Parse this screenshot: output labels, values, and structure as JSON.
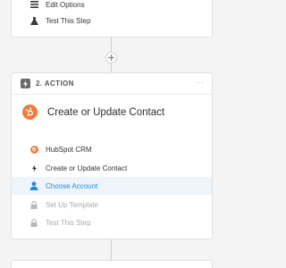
{
  "top_step": {
    "items": [
      {
        "label": "Edit Options",
        "icon": "lines-icon"
      },
      {
        "label": "Test This Step",
        "icon": "flask-icon"
      }
    ]
  },
  "action_step": {
    "label": "2. ACTION",
    "badge_icon": "lightning-icon",
    "menu": "···",
    "app_icon": "hubspot-sprocket-icon",
    "title": "Create or Update Contact",
    "items": [
      {
        "label": "HubSpot CRM",
        "icon": "hubspot-sprocket-icon",
        "state": "done"
      },
      {
        "label": "Create or Update Contact",
        "icon": "lightning-icon",
        "state": "done"
      },
      {
        "label": "Choose Account",
        "icon": "person-icon",
        "state": "selected"
      },
      {
        "label": "Set Up Template",
        "icon": "lock-icon",
        "state": "disabled"
      },
      {
        "label": "Test This Step",
        "icon": "lock-icon",
        "state": "disabled"
      }
    ]
  },
  "colors": {
    "background": "#f4f4f4",
    "hubspot_orange": "#f5793b",
    "selected_blue": "#2f86d1",
    "selected_bg": "#edf5fb",
    "disabled_gray": "#a9a9a9"
  }
}
